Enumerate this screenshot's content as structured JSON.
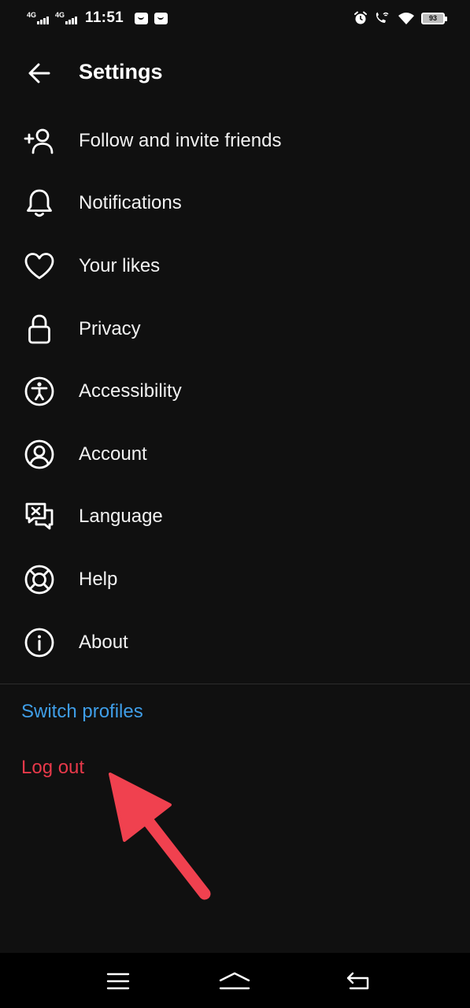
{
  "status_bar": {
    "network_1": "4G",
    "network_2": "4G",
    "time": "11:51",
    "battery_level": "93",
    "icons": [
      "signal-icon",
      "signal-icon",
      "notification-icon",
      "notification-icon",
      "alarm-icon",
      "wifi-calling-icon",
      "wifi-icon",
      "battery-icon"
    ]
  },
  "header": {
    "title": "Settings",
    "back_icon": "arrow-left-icon"
  },
  "menu": {
    "items": [
      {
        "label": "Follow and invite friends",
        "icon": "add-person-icon"
      },
      {
        "label": "Notifications",
        "icon": "bell-icon"
      },
      {
        "label": "Your likes",
        "icon": "heart-icon"
      },
      {
        "label": "Privacy",
        "icon": "lock-icon"
      },
      {
        "label": "Accessibility",
        "icon": "accessibility-icon"
      },
      {
        "label": "Account",
        "icon": "account-icon"
      },
      {
        "label": "Language",
        "icon": "language-icon"
      },
      {
        "label": "Help",
        "icon": "lifebuoy-icon"
      },
      {
        "label": "About",
        "icon": "info-icon"
      }
    ]
  },
  "actions": {
    "switch_profiles": "Switch profiles",
    "log_out": "Log out"
  },
  "colors": {
    "background": "#101010",
    "link_blue": "#3f9ee8",
    "logout_red": "#e8394a",
    "arrow_red": "#f0414f"
  },
  "nav_bar": {
    "icons": [
      "menu-icon",
      "home-icon",
      "back-icon"
    ]
  }
}
